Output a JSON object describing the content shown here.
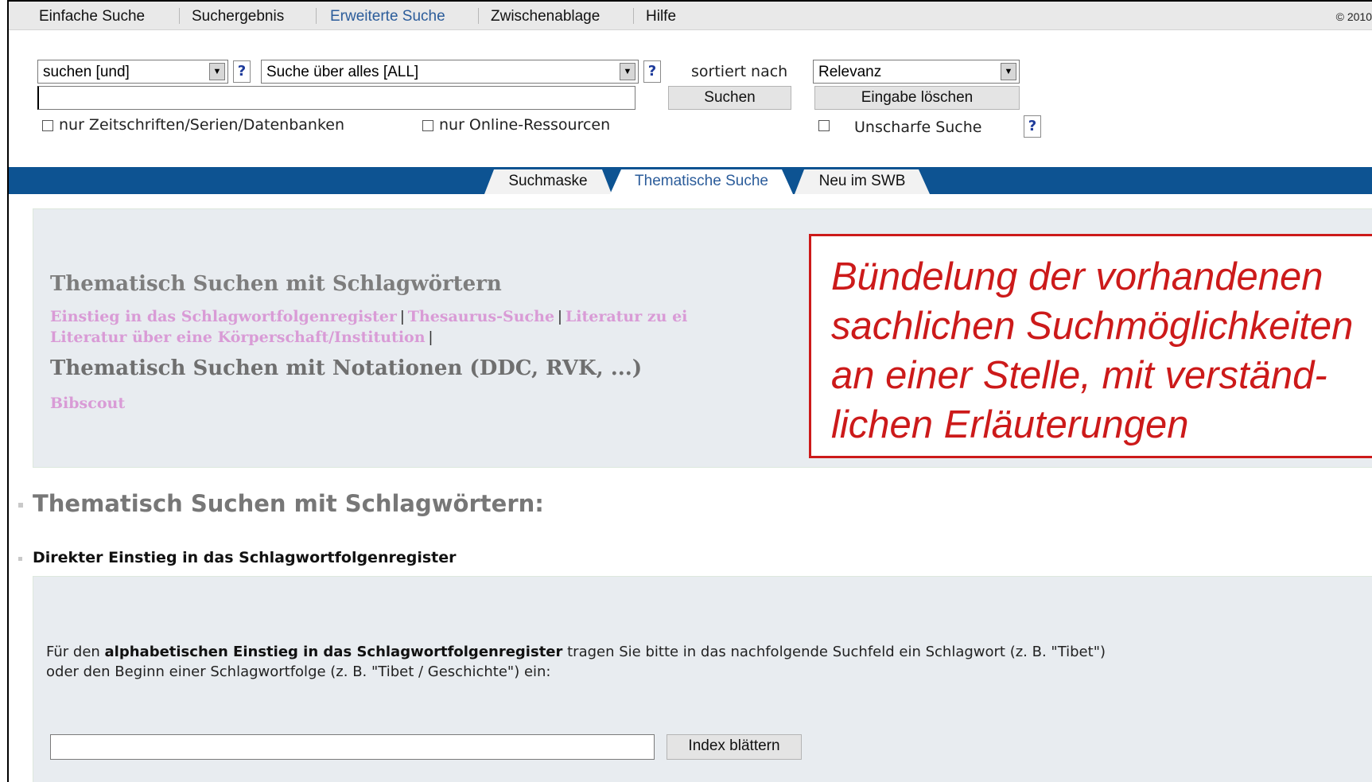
{
  "topnav": {
    "items": [
      "Einfache Suche",
      "Suchergebnis",
      "Erweiterte Suche",
      "Zwischenablage",
      "Hilfe"
    ],
    "copyright": "© 2010"
  },
  "search": {
    "operator_select": "suchen [und]",
    "field_select": "Suche über alles [ALL]",
    "sort_label": "sortiert nach",
    "sort_select": "Relevanz",
    "search_button": "Suchen",
    "clear_button": "Eingabe löschen",
    "checkbox_journals": "nur Zeitschriften/Serien/Datenbanken",
    "checkbox_online": "nur Online-Ressourcen",
    "checkbox_fuzzy": "Unscharfe Suche",
    "help_glyph": "?"
  },
  "tabs": [
    "Suchmaske",
    "Thematische Suche",
    "Neu im SWB"
  ],
  "panel": {
    "title1": "Thematisch Suchen mit Schlagwörtern",
    "link1": "Einstieg in das Schlagwortfolgenregister",
    "link2": "Thesaurus-Suche",
    "link3": "Literatur zu ei",
    "link4": "Literatur über eine Körperschaft/Institution",
    "sep": "|",
    "title2": "Thematisch Suchen mit Notationen (DDC, RVK, ...)",
    "link5": "Bibscout"
  },
  "callout": {
    "lines": [
      "Bündelung der vorhandenen",
      "sachlichen Suchmöglichkeiten",
      "an einer Stelle, mit verständ-",
      "lichen Erläuterungen"
    ]
  },
  "section": {
    "heading": "Thematisch Suchen mit Schlagwörtern:",
    "subheading": "Direkter Einstieg in das Schlagwortfolgenregister",
    "para_part1": "Für den ",
    "para_bold": "alphabetischen Einstieg in das Schlagwortfolgenregister",
    "para_part2": " tragen Sie bitte in das nachfolgende Suchfeld ein Schlagwort (z. B. \"Tibet\")",
    "para_line2": "oder den Beginn einer Schlagwortfolge (z. B. \"Tibet / Geschichte\") ein:",
    "index_button": "Index blättern"
  },
  "colors": {
    "band": "#0d5392",
    "link": "#d99bd6",
    "callout": "#cc1a1a",
    "active_nav": "#2b5c9a"
  }
}
